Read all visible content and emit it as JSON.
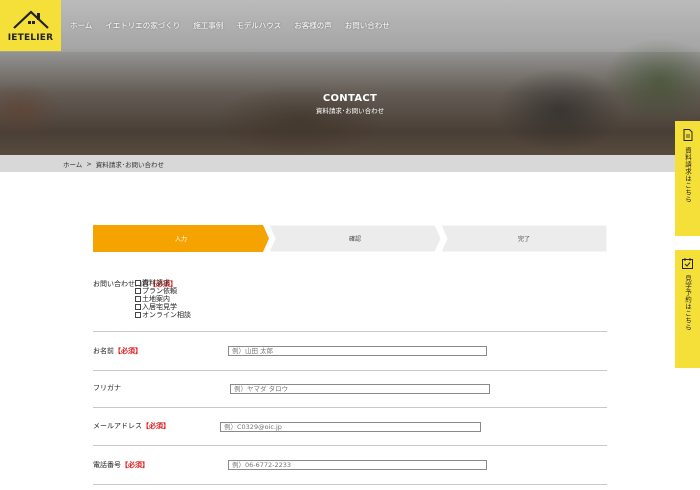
{
  "brand": {
    "logo_text": "IETELIER"
  },
  "nav": [
    {
      "label": "ホーム"
    },
    {
      "label": "イエトリエの家づくり"
    },
    {
      "label": "施工事例"
    },
    {
      "label": "モデルハウス"
    },
    {
      "label": "お客様の声"
    },
    {
      "label": "お問い合わせ"
    }
  ],
  "hero": {
    "title": "CONTACT",
    "subtitle": "資料請求･お問い合わせ"
  },
  "breadcrumb": {
    "home": "ホーム",
    "separator": ">",
    "current": "資料請求･お問い合わせ"
  },
  "steps": [
    {
      "label": "入力",
      "active": true
    },
    {
      "label": "確認",
      "active": false
    },
    {
      "label": "完了",
      "active": false
    }
  ],
  "form": {
    "required_mark": "【必須】",
    "inquiry": {
      "label": "お問い合わせ内容",
      "options": [
        "資料請求",
        "プラン依頼",
        "土地案内",
        "入居宅見学",
        "オンライン相談"
      ]
    },
    "name": {
      "label": "お名前",
      "placeholder": "例）山田 太郎"
    },
    "kana": {
      "label": "フリガナ",
      "placeholder": "例）ヤマダ タロウ"
    },
    "email": {
      "label": "メールアドレス",
      "placeholder": "例）C0329@oic.jp"
    },
    "phone": {
      "label": "電話番号",
      "placeholder": "例）06-6772-2233"
    }
  },
  "side_tabs": [
    {
      "label": "資料請求はこちら",
      "icon": "document-icon"
    },
    {
      "label": "見学予約はこちら",
      "icon": "calendar-check-icon"
    }
  ],
  "colors": {
    "accent_yellow": "#f5e03a",
    "step_active": "#f5a300",
    "required_red": "#e02020"
  }
}
